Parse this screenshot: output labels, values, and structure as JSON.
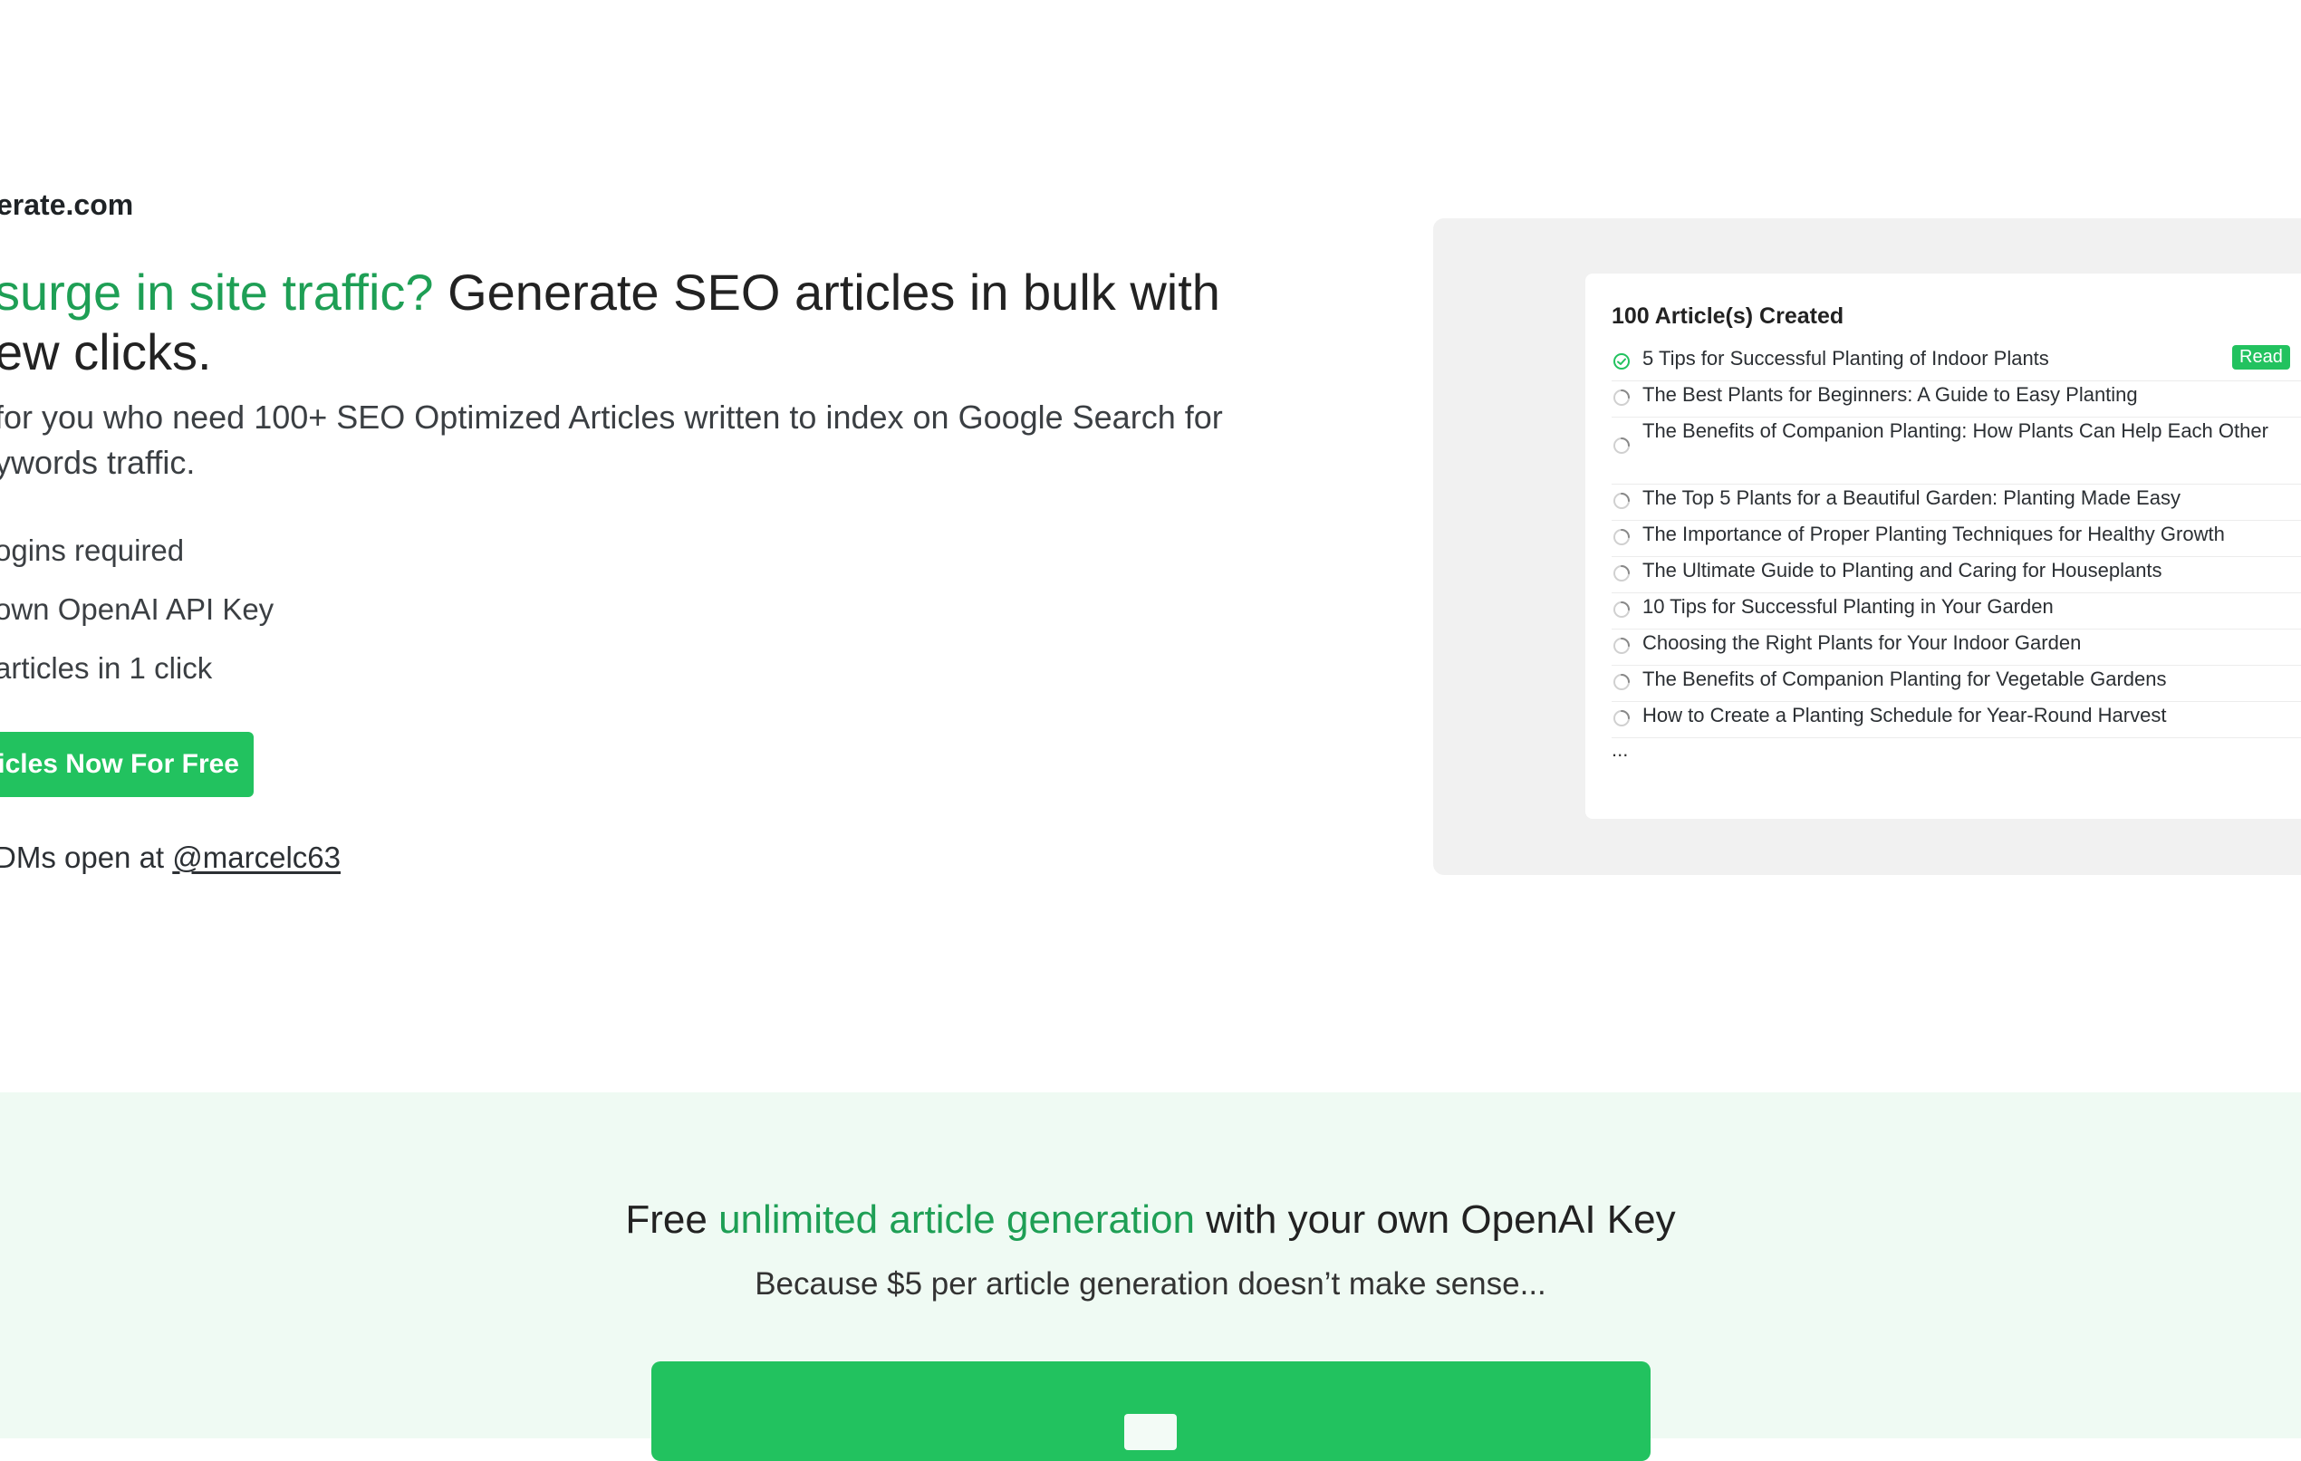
{
  "brand": {
    "text": "erate.com"
  },
  "headline": {
    "highlight": "surge in site traffic?",
    "rest": " Generate SEO articles in bulk with",
    "line2": "ew clicks."
  },
  "subtext": {
    "line1": "for you who need 100+ SEO Optimized Articles written to index on Google Search for",
    "line2": "ywords traffic."
  },
  "features": [
    "ogins required",
    "own OpenAI API Key",
    "articles in 1 click"
  ],
  "cta": {
    "label": "ticles Now For Free"
  },
  "dms": {
    "prefix": "DMs open at ",
    "handle": "@marcelc63"
  },
  "preview": {
    "title": "100 Article(s) Created",
    "read_badge": "Read",
    "articles": [
      {
        "title": "5 Tips for Successful Planting of Indoor Plants",
        "status": "done"
      },
      {
        "title": "The Best Plants for Beginners: A Guide to Easy Planting",
        "status": "pending"
      },
      {
        "title": "The Benefits of Companion Planting: How Plants Can Help Each Other",
        "status": "pending"
      },
      {
        "title": "The Top 5 Plants for a Beautiful Garden: Planting Made Easy",
        "status": "pending"
      },
      {
        "title": "The Importance of Proper Planting Techniques for Healthy Growth",
        "status": "pending"
      },
      {
        "title": "The Ultimate Guide to Planting and Caring for Houseplants",
        "status": "pending"
      },
      {
        "title": "10 Tips for Successful Planting in Your Garden",
        "status": "pending"
      },
      {
        "title": "Choosing the Right Plants for Your Indoor Garden",
        "status": "pending"
      },
      {
        "title": "The Benefits of Companion Planting for Vegetable Gardens",
        "status": "pending"
      },
      {
        "title": "How to Create a Planting Schedule for Year-Round Harvest",
        "status": "pending"
      }
    ],
    "more": "..."
  },
  "pricing": {
    "title_prefix": "Free ",
    "title_highlight": "unlimited article generation",
    "title_suffix": " with your own OpenAI Key",
    "subtitle": "Because $5 per article generation doesn’t make sense..."
  },
  "colors": {
    "accent": "#22c25f",
    "accent_text": "#1e9f55",
    "panel_bg": "#f1f1f1",
    "lower_bg": "#effaf3"
  },
  "icons": {
    "done": "check-circle-icon",
    "pending": "spinner-icon"
  }
}
